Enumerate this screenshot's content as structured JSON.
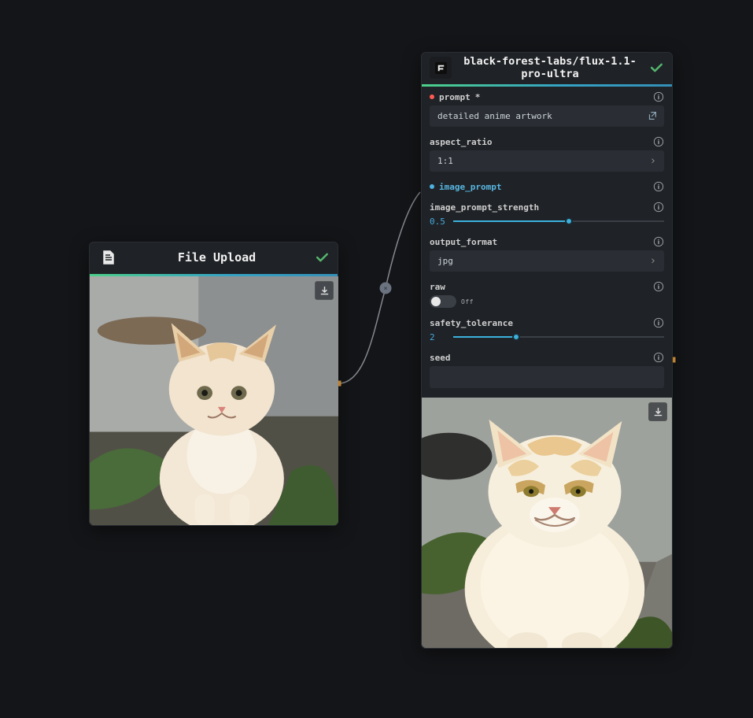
{
  "colors": {
    "accent_gradient_start": "#4cd08a",
    "accent_gradient_end": "#3490b8",
    "slider_color": "#3bb1dc",
    "status_ok": "#55b66d"
  },
  "file_upload_node": {
    "title": "File Upload"
  },
  "model_node": {
    "title": "black-forest-labs/flux-1.1-pro-ultra",
    "params": {
      "prompt": {
        "label": "prompt",
        "required_mark": "*",
        "value": "detailed anime artwork"
      },
      "aspect_ratio": {
        "label": "aspect_ratio",
        "value": "1:1"
      },
      "image_prompt": {
        "label": "image_prompt"
      },
      "image_prompt_strength": {
        "label": "image_prompt_strength",
        "value": "0.5",
        "fill_pct": 55
      },
      "output_format": {
        "label": "output_format",
        "value": "jpg"
      },
      "raw": {
        "label": "raw",
        "state_text": "Off"
      },
      "safety_tolerance": {
        "label": "safety_tolerance",
        "value": "2",
        "fill_pct": 30
      },
      "seed": {
        "label": "seed",
        "value": ""
      }
    }
  }
}
